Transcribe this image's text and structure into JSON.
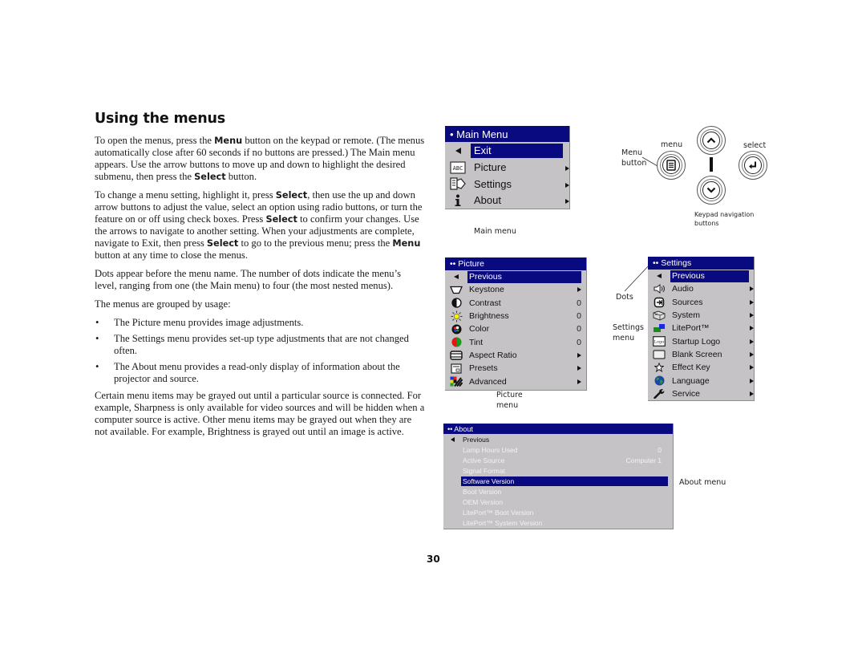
{
  "page": {
    "heading": "Using the menus",
    "page_number": "30"
  },
  "body": {
    "p1": [
      {
        "t": "To open the menus, press the "
      },
      {
        "b": "Menu"
      },
      {
        "t": " button on the keypad or remote. (The menus automatically close after 60 seconds if no buttons are pressed.) The Main menu appears. Use the arrow buttons to move up and down to high­light the desired submenu, then press the "
      },
      {
        "b": "Select"
      },
      {
        "t": " button."
      }
    ],
    "p2": [
      {
        "t": "To change a menu setting, highlight it, press "
      },
      {
        "b": "Select"
      },
      {
        "t": ", then use the up and down arrow buttons to adjust the value, select an option using radio but­tons, or turn the feature on or off using check boxes. Press "
      },
      {
        "b": "Select"
      },
      {
        "t": " to confirm your changes. Use the arrows to navigate to another setting. When your adjustments are complete, navigate to Exit, then press "
      },
      {
        "b": "Select"
      },
      {
        "t": " to go to the previous menu; press the "
      },
      {
        "b": "Menu"
      },
      {
        "t": " button at any time to close the menus."
      }
    ],
    "p3": "Dots appear before the menu name. The number of dots indicate the menu’s level, ranging from one (the Main menu) to four (the most nested menus).",
    "p4": "The menus are grouped by usage:",
    "bullet_char": "•",
    "bullets": [
      "The Picture menu provides image adjustments.",
      "The Settings menu provides set-up type adjustments that are not changed often.",
      "The About menu provides a read-only display of information about the projector and source."
    ],
    "p5": "Certain menu items may be grayed out until a particular source is con­nected. For example, Sharpness is only available for video sources and will be hidden when a computer source is active. Other menu items may be grayed out when they are not available. For example, Brightness is grayed out until an image is active."
  },
  "main_menu": {
    "title": "• Main Menu",
    "items": [
      {
        "label": "Exit",
        "icon": "back-arrow",
        "highlighted": true,
        "value": ""
      },
      {
        "label": "Picture",
        "icon": "abc-picture-icon",
        "value": "▸"
      },
      {
        "label": "Settings",
        "icon": "settings-icon",
        "value": "▸"
      },
      {
        "label": "About",
        "icon": "info-icon",
        "value": "▸"
      }
    ],
    "caption": "Main menu"
  },
  "keypad": {
    "menu_label": "menu",
    "select_label": "select",
    "menu_button_label": "Menu\nbutton",
    "menu_button_line1": "Menu",
    "menu_button_line2": "button",
    "caption_line1": "Keypad navigation",
    "caption_line2": "buttons"
  },
  "picture_menu": {
    "title": "•• Picture",
    "items": [
      {
        "label": "Previous",
        "icon": "back-arrow",
        "highlighted": true,
        "value": ""
      },
      {
        "label": "Keystone",
        "icon": "keystone-icon",
        "value": "▸"
      },
      {
        "label": "Contrast",
        "icon": "contrast-icon",
        "value": "0"
      },
      {
        "label": "Brightness",
        "icon": "brightness-icon",
        "value": "0"
      },
      {
        "label": "Color",
        "icon": "color-icon",
        "value": "0"
      },
      {
        "label": "Tint",
        "icon": "tint-icon",
        "value": "0"
      },
      {
        "label": "Aspect Ratio",
        "icon": "aspect-ratio-icon",
        "value": "▸"
      },
      {
        "label": "Presets",
        "icon": "presets-icon",
        "value": "▸"
      },
      {
        "label": "Advanced",
        "icon": "advanced-icon",
        "value": "▸"
      }
    ],
    "caption_line1": "Picture",
    "caption_line2": "menu"
  },
  "settings_menu": {
    "title": "•• Settings",
    "items": [
      {
        "label": "Previous",
        "icon": "back-arrow",
        "highlighted": true,
        "value": ""
      },
      {
        "label": "Audio",
        "icon": "audio-icon",
        "value": "▸"
      },
      {
        "label": "Sources",
        "icon": "sources-icon",
        "value": "▸"
      },
      {
        "label": "System",
        "icon": "system-icon",
        "value": "▸"
      },
      {
        "label": "LitePort™",
        "icon": "liteport-icon",
        "value": "▸"
      },
      {
        "label": "Startup Logo",
        "icon": "startup-logo-icon",
        "value": "▸"
      },
      {
        "label": "Blank Screen",
        "icon": "blank-screen-icon",
        "value": "▸"
      },
      {
        "label": "Effect Key",
        "icon": "effect-key-icon",
        "value": "▸"
      },
      {
        "label": "Language",
        "icon": "language-icon",
        "value": "▸"
      },
      {
        "label": "Service",
        "icon": "service-icon",
        "value": "▸"
      }
    ],
    "dots_caption": "Dots",
    "caption_line1": "Settings",
    "caption_line2": "menu",
    "logo_glyph": "Logo"
  },
  "about_menu": {
    "title": "•• About",
    "items": [
      {
        "label": "Previous",
        "value": "",
        "grayed": false
      },
      {
        "label": "Lamp Hours Used",
        "value": "0",
        "grayed": true
      },
      {
        "label": "Active Source",
        "value": "Computer 1",
        "grayed": true
      },
      {
        "label": "Signal Format",
        "value": "",
        "grayed": true
      },
      {
        "label": "Software Version",
        "value": "",
        "highlighted": true
      },
      {
        "label": "Boot Version",
        "value": "",
        "grayed": true
      },
      {
        "label": "OEM Version",
        "value": "",
        "grayed": true
      },
      {
        "label": "LitePort™ Boot Version",
        "value": "",
        "grayed": true
      },
      {
        "label": "LitePort™ System Version",
        "value": "",
        "grayed": true
      }
    ],
    "caption": "About menu"
  },
  "colors": {
    "osd_background": "#c6c3c6",
    "osd_highlight": "#0a0a80",
    "osd_grayed_text": "#f2f2f2"
  }
}
